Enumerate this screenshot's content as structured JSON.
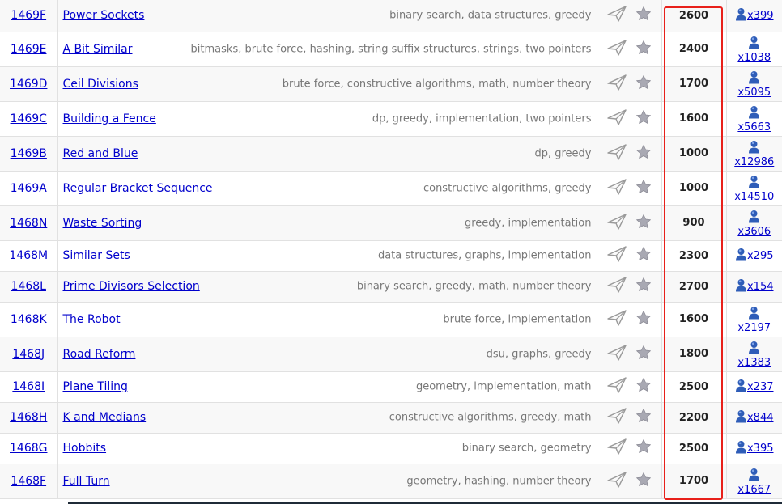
{
  "problems": [
    {
      "id": "1469F",
      "title": "Power Sockets",
      "tags": "binary search, data structures, greedy",
      "rating": "2600",
      "solved": "x399",
      "solved_layout": "inline"
    },
    {
      "id": "1469E",
      "title": "A Bit Similar",
      "tags": "bitmasks, brute force, hashing, string suffix structures, strings, two pointers",
      "rating": "2400",
      "solved": "x1038",
      "solved_layout": "stack"
    },
    {
      "id": "1469D",
      "title": "Ceil Divisions",
      "tags": "brute force, constructive algorithms, math, number theory",
      "rating": "1700",
      "solved": "x5095",
      "solved_layout": "stack"
    },
    {
      "id": "1469C",
      "title": "Building a Fence",
      "tags": "dp, greedy, implementation, two pointers",
      "rating": "1600",
      "solved": "x5663",
      "solved_layout": "stack"
    },
    {
      "id": "1469B",
      "title": "Red and Blue",
      "tags": "dp, greedy",
      "rating": "1000",
      "solved": "x12986",
      "solved_layout": "stack"
    },
    {
      "id": "1469A",
      "title": "Regular Bracket Sequence",
      "tags": "constructive algorithms, greedy",
      "rating": "1000",
      "solved": "x14510",
      "solved_layout": "stack"
    },
    {
      "id": "1468N",
      "title": "Waste Sorting",
      "tags": "greedy, implementation",
      "rating": "900",
      "solved": "x3606",
      "solved_layout": "stack"
    },
    {
      "id": "1468M",
      "title": "Similar Sets",
      "tags": "data structures, graphs, implementation",
      "rating": "2300",
      "solved": "x295",
      "solved_layout": "inline"
    },
    {
      "id": "1468L",
      "title": "Prime Divisors Selection",
      "tags": "binary search, greedy, math, number theory",
      "rating": "2700",
      "solved": "x154",
      "solved_layout": "inline"
    },
    {
      "id": "1468K",
      "title": "The Robot",
      "tags": "brute force, implementation",
      "rating": "1600",
      "solved": "x2197",
      "solved_layout": "stack"
    },
    {
      "id": "1468J",
      "title": "Road Reform",
      "tags": "dsu, graphs, greedy",
      "rating": "1800",
      "solved": "x1383",
      "solved_layout": "stack"
    },
    {
      "id": "1468I",
      "title": "Plane Tiling",
      "tags": "geometry, implementation, math",
      "rating": "2500",
      "solved": "x237",
      "solved_layout": "inline"
    },
    {
      "id": "1468H",
      "title": "K and Medians",
      "tags": "constructive algorithms, greedy, math",
      "rating": "2200",
      "solved": "x844",
      "solved_layout": "inline"
    },
    {
      "id": "1468G",
      "title": "Hobbits",
      "tags": "binary search, geometry",
      "rating": "2500",
      "solved": "x395",
      "solved_layout": "inline"
    },
    {
      "id": "1468F",
      "title": "Full Turn",
      "tags": "geometry, hashing, number theory",
      "rating": "1700",
      "solved": "x1667",
      "solved_layout": "stack"
    }
  ],
  "icons": {
    "submit": "paper-plane-icon",
    "favourite": "star-icon",
    "solved_by": "user-icon"
  },
  "colors": {
    "link": "#0000cc",
    "tags": "#777777",
    "highlight": "#e8201a",
    "row_alt": "#f8f8f8",
    "user_icon": "#2f5db8"
  }
}
